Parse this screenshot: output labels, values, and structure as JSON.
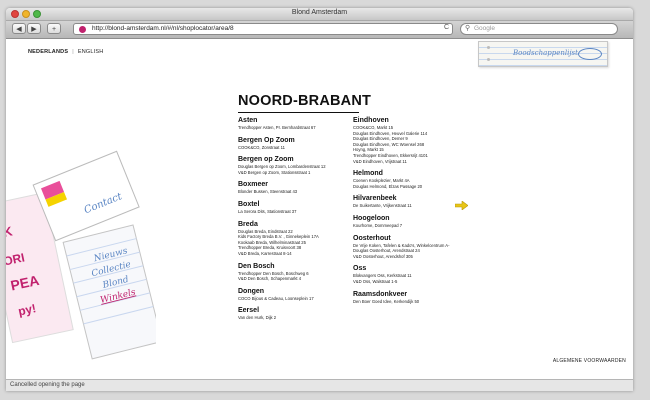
{
  "window": {
    "title": "Blond Amsterdam"
  },
  "toolbar": {
    "back": "◀",
    "forward": "▶",
    "add": "+",
    "url": "http://blond-amsterdam.nl/#/nl/shoplocator/area/8",
    "reload": "C",
    "search_placeholder": "Google"
  },
  "page": {
    "lang_nl": "NEDERLANDS",
    "lang_sep": "|",
    "lang_en": "ENGLISH",
    "shopping_list": "Boodschappenlijst",
    "nav": {
      "contact": "Contact",
      "nieuws": "Nieuws",
      "collectie": "Collectie",
      "blond": "Blond",
      "winkels": "Winkels"
    },
    "area_title": "NOORD-BRABANT",
    "left_column": [
      {
        "city": "Asten",
        "stores": [
          "Trendhopper Asten, Pr. Bernhardstraat 67"
        ]
      },
      {
        "city": "Bergen Op Zoom",
        "stores": [
          "COOK&CO, Zonstraat 11"
        ]
      },
      {
        "city": "Bergen op Zoom",
        "stores": [
          "Douglas Bergen op Zoom, Lombardenstraat 12",
          "V&D Bergen op Zoom, Stationsstraat 1"
        ]
      },
      {
        "city": "Boxmeer",
        "stores": [
          "Blonder Bussen, Steenstraat 43"
        ]
      },
      {
        "city": "Boxtel",
        "stores": [
          "La Serora Dits, Stationstraat 37"
        ]
      },
      {
        "city": "Breda",
        "stores": [
          "Douglas Breda, Eindstraat 22",
          "Kids Factory Breda B.V. , Ginnekeplein 17A",
          "Kookaab Breda, Wilhelminastraat 25",
          "Trendhopper Breda, Kruisvoort 38",
          "V&D Breda, Karrestraat 8-14"
        ]
      },
      {
        "city": "Den Bosch",
        "stores": [
          "Trendhopper Den Bosch, Boschweg 6",
          "V&D Den Bosch, Schapenmarkt 4"
        ]
      },
      {
        "city": "Dongen",
        "stores": [
          "COCO Bijous & Cadeau, Loonseplein 17"
        ]
      },
      {
        "city": "Eersel",
        "stores": [
          "Van den Hurk, Dijk 2"
        ]
      }
    ],
    "right_column": [
      {
        "city": "Eindhoven",
        "stores": [
          "COOK&CO, Markt 15",
          "Douglas Eindhoven, Heuvel Galerie 114",
          "Douglas Eindhoven, Demer 9",
          "Douglas Eindhoven, WC Woensel 268",
          "Hoyng, Markt 15",
          "Trendhopper Eindhoven, Ekkersrijt 4101",
          "V&D Eindhoven, Vrijstraat 11"
        ]
      },
      {
        "city": "Helmond",
        "stores": [
          "Coenen Kookplezier, Markt 4A",
          "Douglas Helmond, Elzas Passage 20"
        ]
      },
      {
        "city": "Hilvarenbeek",
        "stores": [
          "De Suikertante, Vrijkenstraat 11"
        ]
      },
      {
        "city": "Hoogeloon",
        "stores": [
          "Kourhome, Dommeepad 7"
        ]
      },
      {
        "city": "Oosterhout",
        "stores": [
          "De Vrije Koken, Tafelen & Kado's, Winkelcentrum A-",
          "Douglas Oosterhout, Arendstraat 24",
          "V&D Oosterhout, Arendshof 305"
        ]
      },
      {
        "city": "Oss",
        "stores": [
          "Blokvangers Oss, Kerkstraat 11",
          "V&D Oss, Walstraat 1-5"
        ]
      },
      {
        "city": "Raamsdonkveer",
        "stores": [
          "Den Boer Goed Idee, Kerkendijk 50"
        ]
      }
    ],
    "footer_link": "ALGEMENE VOORWAARDEN"
  },
  "status": {
    "text": "Cancelled opening the page"
  },
  "colors": {
    "accent_pink": "#c1226e",
    "ink_blue": "#5b86c4",
    "arrow_yellow": "#e8c516"
  }
}
